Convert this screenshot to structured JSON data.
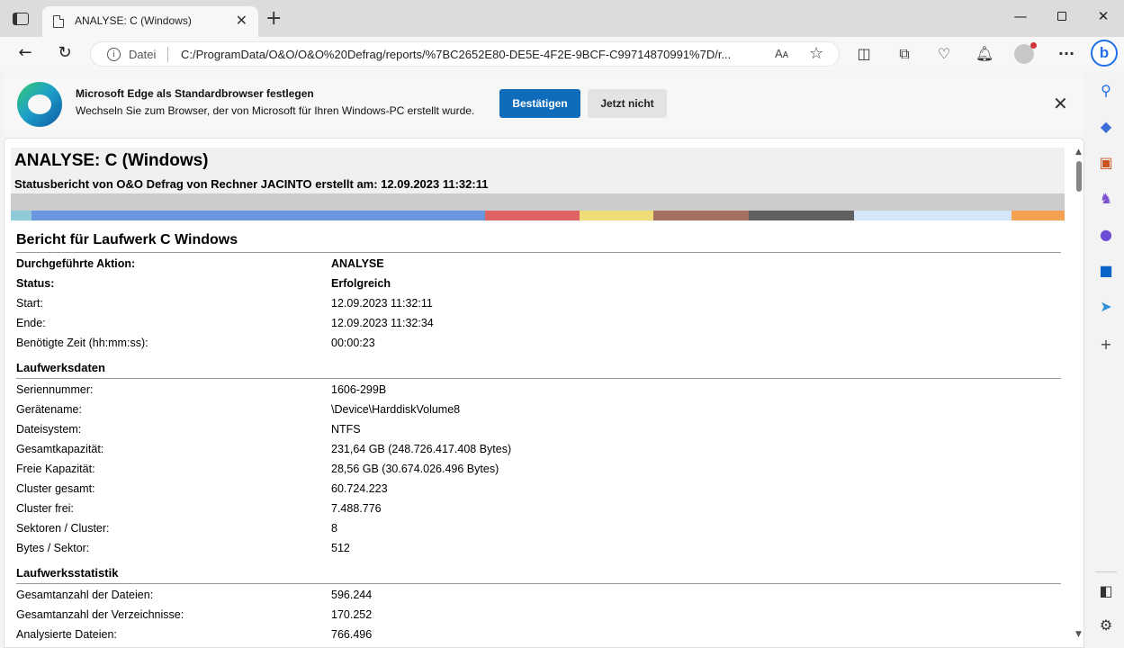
{
  "browser": {
    "tab_title": "ANALYSE: C (Windows)",
    "address_scheme": "Datei",
    "address_url": "C:/ProgramData/O&O/O&O%20Defrag/reports/%7BC2652E80-DE5E-4F2E-9BCF-C99714870991%7D/r...",
    "read_aloud_label": "Aᴀ",
    "bing_label": "b"
  },
  "banner": {
    "title": "Microsoft Edge als Standardbrowser festlegen",
    "text": "Wechseln Sie zum Browser, der von Microsoft für Ihren Windows-PC erstellt wurde.",
    "confirm_label": "Bestätigen",
    "later_label": "Jetzt nicht"
  },
  "report": {
    "title": "ANALYSE: C (Windows)",
    "subtitle": "Statusbericht von O&O Defrag von Rechner JACINTO erstellt am: 12.09.2023 11:32:11",
    "color_bar": [
      {
        "color": "#8ecad8",
        "share": 2
      },
      {
        "color": "#6b96e0",
        "share": 43
      },
      {
        "color": "#e06363",
        "share": 9
      },
      {
        "color": "#efdc74",
        "share": 7
      },
      {
        "color": "#a57060",
        "share": 9
      },
      {
        "color": "#606060",
        "share": 10
      },
      {
        "color": "#d4e6f8",
        "share": 15
      },
      {
        "color": "#f3a254",
        "share": 5
      }
    ],
    "section_title": "Bericht für Laufwerk C Windows",
    "summary": [
      {
        "label": "Durchgeführte Aktion:",
        "value": "ANALYSE"
      },
      {
        "label": "Status:",
        "value": "Erfolgreich"
      },
      {
        "label": "Start:",
        "value": "12.09.2023 11:32:11"
      },
      {
        "label": "Ende:",
        "value": "12.09.2023 11:32:34"
      },
      {
        "label": "Benötigte Zeit (hh:mm:ss):",
        "value": "00:00:23"
      }
    ],
    "drive_title": "Laufwerksdaten",
    "drive": [
      {
        "label": "Seriennummer:",
        "value": "1606-299B"
      },
      {
        "label": "Gerätename:",
        "value": "\\Device\\HarddiskVolume8"
      },
      {
        "label": "Dateisystem:",
        "value": "NTFS"
      },
      {
        "label": "Gesamtkapazität:",
        "value": "231,64 GB (248.726.417.408 Bytes)"
      },
      {
        "label": "Freie Kapazität:",
        "value": "28,56 GB (30.674.026.496 Bytes)"
      },
      {
        "label": "Cluster gesamt:",
        "value": "60.724.223"
      },
      {
        "label": "Cluster frei:",
        "value": "7.488.776"
      },
      {
        "label": "Sektoren / Cluster:",
        "value": "8"
      },
      {
        "label": "Bytes / Sektor:",
        "value": "512"
      }
    ],
    "stats_title": "Laufwerksstatistik",
    "stats": [
      {
        "label": "Gesamtanzahl der Dateien:",
        "value": "596.244"
      },
      {
        "label": "Gesamtanzahl der Verzeichnisse:",
        "value": "170.252"
      },
      {
        "label": "Analysierte Dateien:",
        "value": "766.496"
      }
    ]
  },
  "sidebar_icons": [
    "search-icon",
    "tag-icon",
    "toolbox-icon",
    "games-icon",
    "office-icon",
    "outlook-icon",
    "send-icon",
    "add-icon",
    "sidepanel-icon",
    "settings-icon"
  ]
}
